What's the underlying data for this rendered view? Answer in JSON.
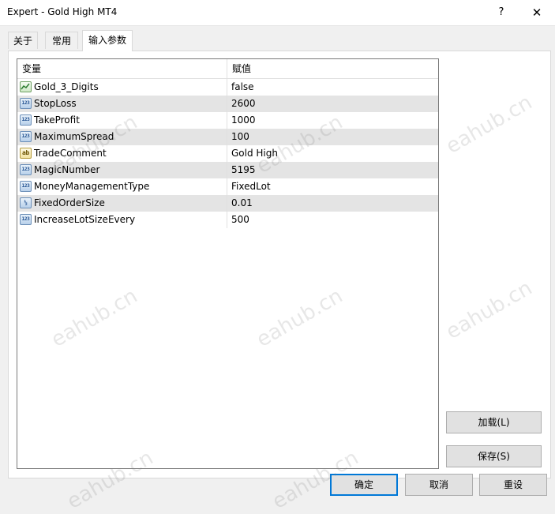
{
  "window": {
    "title": "Expert - Gold High MT4",
    "help_label": "?",
    "close_label": "✕"
  },
  "tabs": [
    {
      "label": "关于"
    },
    {
      "label": "常用"
    },
    {
      "label": "输入参数"
    }
  ],
  "active_tab": "输入参数",
  "grid": {
    "headers": {
      "variable": "变量",
      "value": "赋值"
    },
    "rows": [
      {
        "icon": "bool-type-icon",
        "icon_text": "",
        "name": "Gold_3_Digits",
        "value": "false"
      },
      {
        "icon": "int-type-icon",
        "icon_text": "123",
        "name": "StopLoss",
        "value": "2600"
      },
      {
        "icon": "int-type-icon",
        "icon_text": "123",
        "name": "TakeProfit",
        "value": "1000"
      },
      {
        "icon": "int-type-icon",
        "icon_text": "123",
        "name": "MaximumSpread",
        "value": "100"
      },
      {
        "icon": "string-type-icon",
        "icon_text": "ab",
        "name": "TradeComment",
        "value": "Gold High"
      },
      {
        "icon": "int-type-icon",
        "icon_text": "123",
        "name": "MagicNumber",
        "value": "5195"
      },
      {
        "icon": "int-type-icon",
        "icon_text": "123",
        "name": "MoneyManagementType",
        "value": "FixedLot"
      },
      {
        "icon": "double-type-icon",
        "icon_text": "½",
        "name": "FixedOrderSize",
        "value": "0.01"
      },
      {
        "icon": "int-type-icon",
        "icon_text": "123",
        "name": "IncreaseLotSizeEvery",
        "value": "500"
      }
    ]
  },
  "buttons": {
    "load": "加载(L)",
    "save": "保存(S)",
    "ok": "确定",
    "cancel": "取消",
    "reset": "重设"
  },
  "watermark": "eahub.cn",
  "colors": {
    "accent": "#0078d7",
    "row_alt": "#e4e4e4"
  }
}
